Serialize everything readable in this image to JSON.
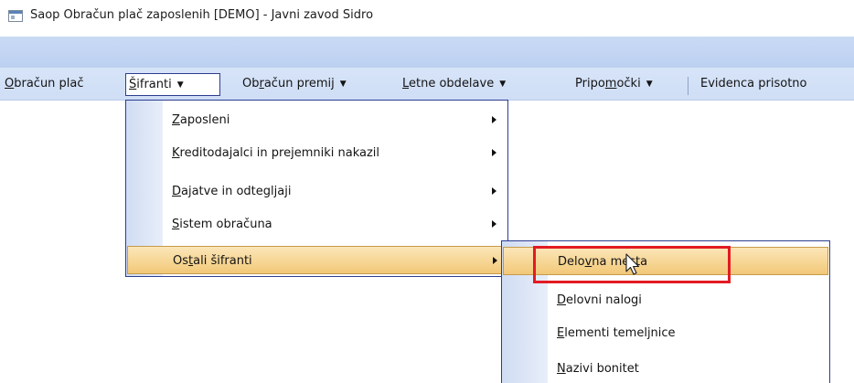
{
  "window": {
    "title": "Saop Obračun plač zaposlenih  [DEMO] - Javni zavod Sidro",
    "icon": "app-window-icon"
  },
  "menubar": {
    "items": [
      {
        "label_pre": "",
        "label_mn": "O",
        "label_post": "bračun plač",
        "arrow": ""
      },
      {
        "label_pre": "",
        "label_mn": "Š",
        "label_post": "ifranti",
        "arrow": "▼"
      },
      {
        "label_pre": "Ob",
        "label_mn": "r",
        "label_post": "ačun premij",
        "arrow": "▼"
      },
      {
        "label_pre": "",
        "label_mn": "L",
        "label_post": "etne obdelave",
        "arrow": "▼"
      },
      {
        "label_pre": "Pripo",
        "label_mn": "m",
        "label_post": "očki",
        "arrow": "▼"
      },
      {
        "label_pre": "Evidenca prisotno",
        "label_mn": "",
        "label_post": "",
        "arrow": ""
      }
    ]
  },
  "dropdown": {
    "items": [
      {
        "label_pre": "",
        "label_mn": "Z",
        "label_post": "aposleni"
      },
      {
        "label_pre": "",
        "label_mn": "K",
        "label_post": "reditodajalci in prejemniki nakazil"
      },
      {
        "label_pre": "",
        "label_mn": "D",
        "label_post": "ajatve in odtegljaji"
      },
      {
        "label_pre": "",
        "label_mn": "S",
        "label_post": "istem obračuna"
      },
      {
        "label_pre": "Os",
        "label_mn": "t",
        "label_post": "ali šifranti"
      }
    ]
  },
  "submenu": {
    "items": [
      {
        "label_pre": "Delo",
        "label_mn": "v",
        "label_post": "na mesta"
      },
      {
        "label_pre": "",
        "label_mn": "D",
        "label_post": "elovni nalogi"
      },
      {
        "label_pre": "",
        "label_mn": "E",
        "label_post": "lementi temeljnice"
      },
      {
        "label_pre": "",
        "label_mn": "N",
        "label_post": "azivi bonitet"
      }
    ]
  },
  "colors": {
    "menubar_bg": "#d7e4f8",
    "highlight": "#f2c878",
    "menu_border": "#2c3d8f",
    "annotation_red": "#e21b23"
  }
}
